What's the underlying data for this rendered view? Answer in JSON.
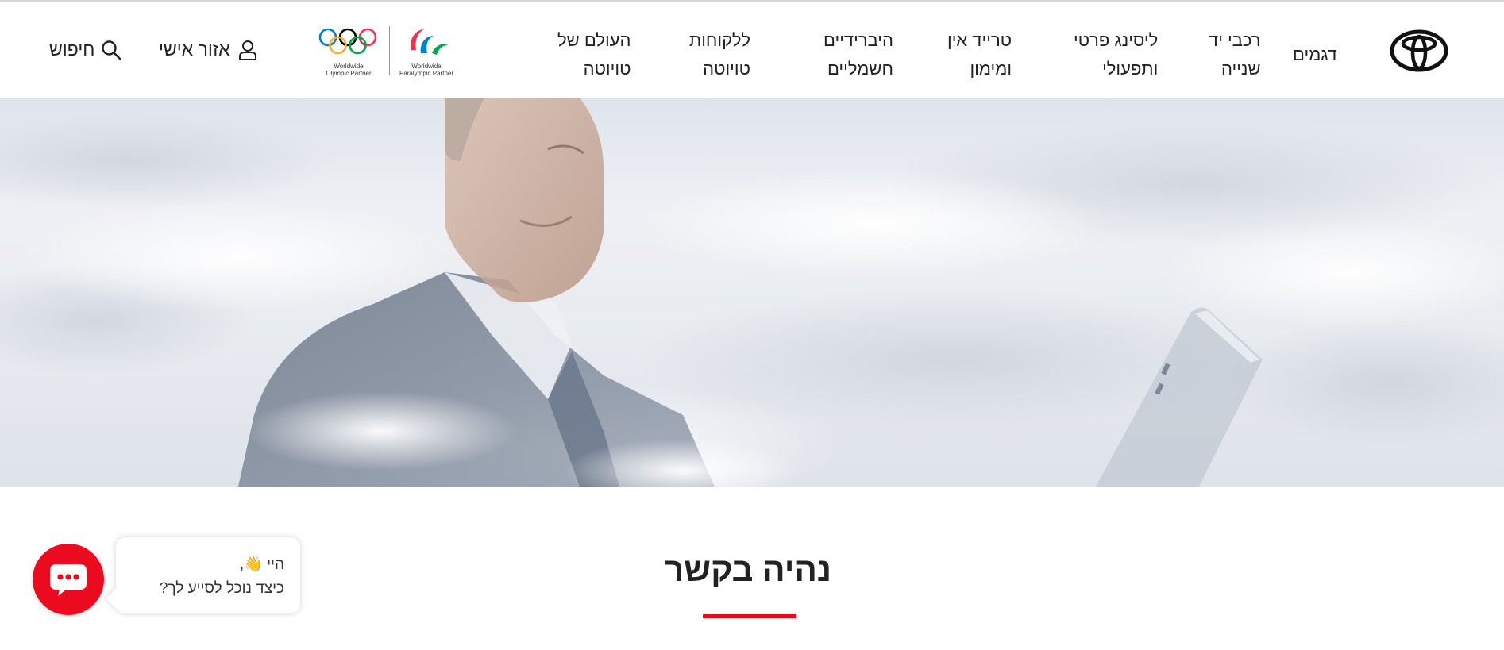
{
  "header": {
    "brand": "Toyota",
    "nav_items": [
      {
        "line1": "דגמים",
        "line2": ""
      },
      {
        "line1": "רכבי יד",
        "line2": "שנייה"
      },
      {
        "line1": "ליסינג פרטי",
        "line2": "ותפעולי"
      },
      {
        "line1": "טרייד אין",
        "line2": "ומימון"
      },
      {
        "line1": "היברידיים",
        "line2": "חשמליים"
      },
      {
        "line1": "ללקוחות",
        "line2": "טויוטה"
      },
      {
        "line1": "העולם של",
        "line2": "טויוטה"
      }
    ],
    "partners": {
      "olympic_caption_1": "Worldwide",
      "olympic_caption_2": "Olympic Partner",
      "paralympic_caption_1": "Worldwide",
      "paralympic_caption_2": "Paralympic Partner"
    },
    "personal_area": {
      "label": "אזור אישי",
      "icon": "user-icon"
    },
    "search": {
      "label": "חיפוש",
      "icon": "search-icon"
    }
  },
  "main": {
    "title": "נהיה בקשר"
  },
  "chat": {
    "greeting": "היי 👋,",
    "question": "כיצד נוכל לסייע לך?",
    "icon": "chat-dots-icon"
  },
  "colors": {
    "accent": "#eb0a1e",
    "text": "#222222"
  }
}
